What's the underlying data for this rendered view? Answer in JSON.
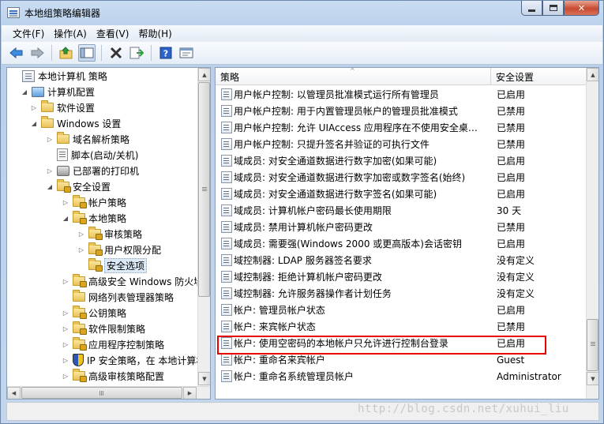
{
  "window": {
    "title": "本地组策略编辑器",
    "minimize_icon": "minimize-icon",
    "maximize_icon": "maximize-icon",
    "close_label": "✕"
  },
  "menu": [
    "文件(F)",
    "操作(A)",
    "查看(V)",
    "帮助(H)"
  ],
  "toolbar": {
    "buttons": [
      "back-arrow-icon",
      "forward-arrow-icon",
      "up-folder-icon",
      "show-hide-tree-icon",
      "delete-x-icon",
      "export-list-icon",
      "help-icon",
      "properties-icon"
    ]
  },
  "tree": {
    "items": [
      {
        "label": "本地计算机 策略",
        "icon": "policy-icon",
        "expander": ""
      },
      {
        "label": "计算机配置",
        "icon": "computer-icon",
        "expander": "◢"
      },
      {
        "label": "软件设置",
        "icon": "folder-icon",
        "expander": "▷"
      },
      {
        "label": "Windows 设置",
        "icon": "folder-icon",
        "expander": "◢"
      },
      {
        "label": "域名解析策略",
        "icon": "folder-icon",
        "expander": "▷"
      },
      {
        "label": "脚本(启动/关机)",
        "icon": "script-icon",
        "expander": ""
      },
      {
        "label": "已部署的打印机",
        "icon": "printer-icon",
        "expander": "▷"
      },
      {
        "label": "安全设置",
        "icon": "locked-folder-icon",
        "expander": "◢"
      },
      {
        "label": "帐户策略",
        "icon": "locked-folder-icon",
        "expander": "▷"
      },
      {
        "label": "本地策略",
        "icon": "locked-folder-icon",
        "expander": "◢"
      },
      {
        "label": "审核策略",
        "icon": "locked-folder-icon",
        "expander": "▷"
      },
      {
        "label": "用户权限分配",
        "icon": "locked-folder-icon",
        "expander": "▷"
      },
      {
        "label": "安全选项",
        "icon": "locked-folder-icon",
        "expander": ""
      },
      {
        "label": "高级安全 Windows 防火墙",
        "icon": "locked-folder-icon",
        "expander": "▷"
      },
      {
        "label": "网络列表管理器策略",
        "icon": "folder-icon",
        "expander": ""
      },
      {
        "label": "公钥策略",
        "icon": "locked-folder-icon",
        "expander": "▷"
      },
      {
        "label": "软件限制策略",
        "icon": "locked-folder-icon",
        "expander": "▷"
      },
      {
        "label": "应用程序控制策略",
        "icon": "locked-folder-icon",
        "expander": "▷"
      },
      {
        "label": "IP 安全策略，在 本地计算机",
        "icon": "shield-icon",
        "expander": "▷"
      },
      {
        "label": "高级审核策略配置",
        "icon": "locked-folder-icon",
        "expander": "▷"
      }
    ]
  },
  "list": {
    "headers": {
      "policy": "策略",
      "setting": "安全设置"
    },
    "rows": [
      {
        "name": "用户帐户控制: 以管理员批准模式运行所有管理员",
        "value": "已启用"
      },
      {
        "name": "用户帐户控制: 用于内置管理员帐户的管理员批准模式",
        "value": "已禁用"
      },
      {
        "name": "用户帐户控制: 允许 UIAccess 应用程序在不使用安全桌面...",
        "value": "已禁用"
      },
      {
        "name": "用户帐户控制: 只提升签名并验证的可执行文件",
        "value": "已禁用"
      },
      {
        "name": "域成员: 对安全通道数据进行数字加密(如果可能)",
        "value": "已启用"
      },
      {
        "name": "域成员: 对安全通道数据进行数字加密或数字签名(始终)",
        "value": "已启用"
      },
      {
        "name": "域成员: 对安全通道数据进行数字签名(如果可能)",
        "value": "已启用"
      },
      {
        "name": "域成员: 计算机帐户密码最长使用期限",
        "value": "30 天"
      },
      {
        "name": "域成员: 禁用计算机帐户密码更改",
        "value": "已禁用"
      },
      {
        "name": "域成员: 需要强(Windows 2000 或更高版本)会话密钥",
        "value": "已启用"
      },
      {
        "name": "域控制器: LDAP 服务器签名要求",
        "value": "没有定义"
      },
      {
        "name": "域控制器: 拒绝计算机帐户密码更改",
        "value": "没有定义"
      },
      {
        "name": "域控制器: 允许服务器操作者计划任务",
        "value": "没有定义"
      },
      {
        "name": "帐户: 管理员帐户状态",
        "value": "已启用"
      },
      {
        "name": "帐户: 来宾帐户状态",
        "value": "已禁用"
      },
      {
        "name": "帐户: 使用空密码的本地帐户只允许进行控制台登录",
        "value": "已启用"
      },
      {
        "name": "帐户: 重命名来宾帐户",
        "value": "Guest"
      },
      {
        "name": "帐户: 重命名系统管理员帐户",
        "value": "Administrator"
      }
    ],
    "highlight_color": "#e60000"
  },
  "scrollbar_glyphs": {
    "up": "▲",
    "down": "▼",
    "left": "◀",
    "right": "▶"
  },
  "watermark": "http://blog.csdn.net/xuhui_liu"
}
